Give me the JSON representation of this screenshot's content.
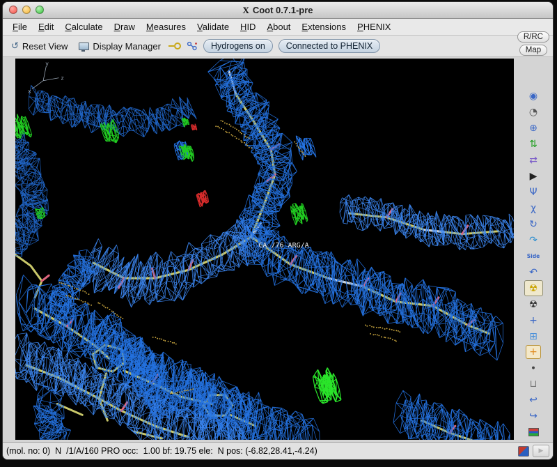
{
  "window": {
    "title": "Coot 0.7.1-pre",
    "x11_glyph": "X"
  },
  "menu": {
    "items": [
      {
        "name": "menu-item-file",
        "label": "File"
      },
      {
        "name": "menu-item-edit",
        "label": "Edit"
      },
      {
        "name": "menu-item-calculate",
        "label": "Calculate"
      },
      {
        "name": "menu-item-draw",
        "label": "Draw"
      },
      {
        "name": "menu-item-measures",
        "label": "Measures"
      },
      {
        "name": "menu-item-validate",
        "label": "Validate"
      },
      {
        "name": "menu-item-hid",
        "label": "HID"
      },
      {
        "name": "menu-item-about",
        "label": "About"
      },
      {
        "name": "menu-item-extensions",
        "label": "Extensions"
      },
      {
        "name": "menu-item-phenix",
        "label": "PHENIX"
      }
    ]
  },
  "toolbar": {
    "reset_view": "Reset View",
    "display_manager": "Display Manager",
    "hydrogens": "Hydrogens on",
    "phenix": "Connected to PHENIX",
    "icons": {
      "reset_glyph": "↺"
    }
  },
  "side_panel": {
    "rrc": "R/RC",
    "map": "Map"
  },
  "right_toolbar": {
    "icons": [
      {
        "name": "real-space-refine-icon",
        "glyph": "◉",
        "color": "#3a67c6"
      },
      {
        "name": "regularize-zone-icon",
        "glyph": "◔",
        "color": "#555555"
      },
      {
        "name": "fix-atoms-icon",
        "glyph": "⊕",
        "color": "#3a67c6"
      },
      {
        "name": "rigid-body-fit-icon",
        "glyph": "⇅",
        "color": "#1f9e1f"
      },
      {
        "name": "rotate-translate-icon",
        "glyph": "⇄",
        "color": "#7a5bc8"
      },
      {
        "name": "auto-fit-rotamer-icon",
        "glyph": "▶",
        "color": "#222222"
      },
      {
        "name": "rotamers-icon",
        "glyph": "Ψ",
        "color": "#3a67c6"
      },
      {
        "name": "edit-chi-angles-icon",
        "glyph": "χ",
        "color": "#3a67c6"
      },
      {
        "name": "torsion-general-icon",
        "glyph": "↻",
        "color": "#3a67c6"
      },
      {
        "name": "flip-peptide-icon",
        "glyph": "↷",
        "color": "#2f8fcf"
      },
      {
        "name": "side-chain-flip-icon",
        "glyph": "Side",
        "color": "#3a67c6",
        "kind": "text"
      },
      {
        "name": "jed-flip-icon",
        "glyph": "↶",
        "color": "#3a67c6"
      },
      {
        "name": "mutate-autofit-icon",
        "glyph": "☢",
        "color": "#c9a400",
        "selected": true
      },
      {
        "name": "simple-mutate-icon",
        "glyph": "☢",
        "color": "#333333"
      },
      {
        "name": "add-terminal-residue-icon",
        "glyph": "+",
        "color": "#3a67c6"
      },
      {
        "name": "add-alt-conf-icon",
        "glyph": "⊞",
        "color": "#4a90d9"
      },
      {
        "name": "place-atom-icon",
        "glyph": "+",
        "color": "#e08a1e",
        "kind": "boxed"
      },
      {
        "name": "pointer-atom-icon",
        "glyph": "∙",
        "color": "#444444"
      },
      {
        "name": "delete-item-icon",
        "glyph": "⊔",
        "color": "#777777"
      },
      {
        "name": "undo-icon",
        "glyph": "↩",
        "color": "#3a67c6"
      },
      {
        "name": "redo-icon",
        "glyph": "↪",
        "color": "#3a67c6"
      },
      {
        "name": "run-refmac-icon",
        "glyph": "",
        "color": "#b23b3b",
        "kind": "flag"
      }
    ]
  },
  "canvas": {
    "atom_label": "CA /76 ARG/A",
    "axis_labels": {
      "x": "x",
      "y": "y",
      "z": "z"
    },
    "colors": {
      "mesh": "#2473e3",
      "mesh_light": "#3b86f0",
      "sticks": "#c9c86a",
      "light_sticks": "#ccd3db",
      "stubs": "#e0667e",
      "positive_diff": "#21cc21",
      "positive_diff_bright": "#2ae52a",
      "negative_diff": "#d62b2b",
      "dots": "#c7a43e",
      "axes": "#9aa6b4"
    }
  },
  "statusbar": {
    "text": "(mol. no: 0)  N  /1/A/160 PRO occ:  1.00 bf: 19.75 ele:  N pos: (-6.82,28.41,-4.24)",
    "play_glyph": "▶"
  }
}
